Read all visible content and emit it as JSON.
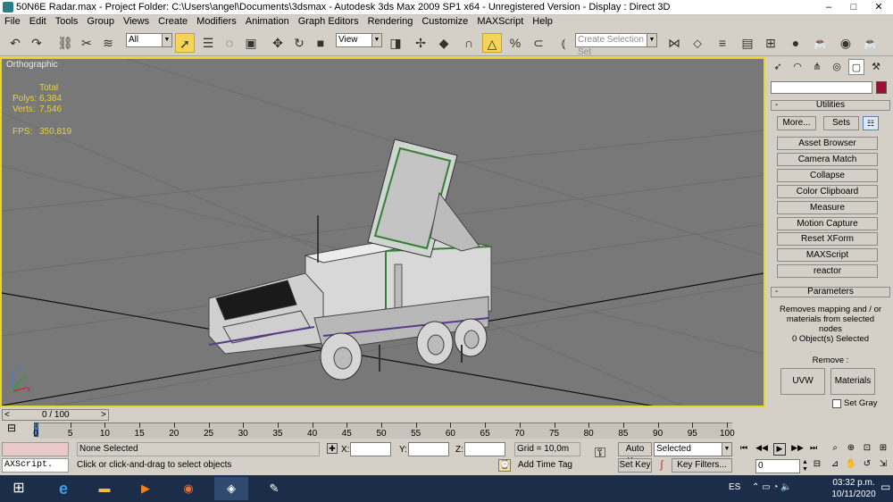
{
  "title": {
    "text": "50N6E Radar.max    - Project Folder: C:\\Users\\angel\\Documents\\3dsmax     - Autodesk 3ds Max  2009 SP1  x64   - Unregistered Version        - Display : Direct 3D"
  },
  "window_controls": {
    "minimize": "–",
    "maximize": "□",
    "close": "✕"
  },
  "menubar": [
    "File",
    "Edit",
    "Tools",
    "Group",
    "Views",
    "Create",
    "Modifiers",
    "Animation",
    "Graph Editors",
    "Rendering",
    "Customize",
    "MAXScript",
    "Help"
  ],
  "toolbar": {
    "selection_filter": "All",
    "reference_coord": "View",
    "named_selection_placeholder": "Create Selection Set",
    "icons": [
      "undo-icon",
      "redo-icon",
      "select-link-icon",
      "unlink-icon",
      "bind-spacewarp-icon",
      "select-object-icon",
      "select-by-name-icon",
      "region-select-icon",
      "window-crossing-icon",
      "move-icon",
      "rotate-icon",
      "scale-icon",
      "pivot-icon",
      "mirror-icon",
      "align-icon",
      "snap-icon",
      "angle-snap-icon",
      "percent-snap-icon",
      "spinner-snap-icon",
      "edit-named-sets-icon",
      "mirror-tool-icon",
      "align-tool-icon",
      "layers-icon",
      "curve-editor-icon",
      "schematic-icon",
      "material-editor-icon",
      "render-scene-icon",
      "quick-render-icon",
      "render-icon"
    ]
  },
  "viewport": {
    "label": "Orthographic",
    "stats": {
      "total_label": "Total",
      "polys_label": "Polys:",
      "polys_value": "6,384",
      "verts_label": "Verts:",
      "verts_value": "7,546",
      "fps_label": "FPS:",
      "fps_value": "350,819"
    },
    "axis": {
      "x": "x",
      "y": "y",
      "z": "z"
    }
  },
  "command_panel": {
    "tab_icons": [
      "create-tab-icon",
      "modify-tab-icon",
      "hierarchy-tab-icon",
      "motion-tab-icon",
      "display-tab-icon",
      "utilities-tab-icon"
    ],
    "name_field": "",
    "color_swatch": "#9e0f35",
    "utilities_rollout": "Utilities",
    "more_button": "More...",
    "sets_button": "Sets",
    "utility_buttons": [
      "Asset Browser",
      "Camera Match",
      "Collapse",
      "Color Clipboard",
      "Measure",
      "Motion Capture",
      "Reset XForm",
      "MAXScript",
      "reactor"
    ],
    "parameters_rollout": "Parameters",
    "description": "Removes mapping and / or materials from selected nodes",
    "selection_status": "0 Object(s) Selected",
    "remove_label": "Remove :",
    "uvw_button": "UVW",
    "materials_button": "Materials",
    "set_gray_label": "Set Gray",
    "minus": "-"
  },
  "timeline": {
    "slider_value": "0 / 100",
    "prev": "<",
    "next": ">",
    "ticks": [
      "0",
      "5",
      "10",
      "15",
      "20",
      "25",
      "30",
      "35",
      "40",
      "45",
      "50",
      "55",
      "60",
      "65",
      "70",
      "75",
      "80",
      "85",
      "90",
      "95",
      "100"
    ]
  },
  "statusbar": {
    "selection_info": "None Selected",
    "prompt": "Click or click-and-drag to select objects",
    "maxscript_label": "AXScript.",
    "x_label": "X:",
    "y_label": "Y:",
    "z_label": "Z:",
    "x_value": "",
    "y_value": "",
    "z_value": "",
    "grid": "Grid = 10,0m",
    "add_time_tag": "Add Time Tag",
    "auto_key": "Auto Key",
    "set_key": "Set Key",
    "key_mode": "Selected",
    "key_filters": "Key Filters...",
    "frame_value": "0"
  },
  "playback_icons": [
    "go-start-icon",
    "prev-frame-icon",
    "play-icon",
    "next-frame-icon",
    "go-end-icon"
  ],
  "nav_icons": [
    "zoom-icon",
    "zoom-all-icon",
    "zoom-extents-icon",
    "zoom-extents-all-icon",
    "fov-icon",
    "pan-icon",
    "orbit-icon",
    "maximize-viewport-icon"
  ],
  "taskbar": {
    "apps": [
      "start-icon",
      "edge-icon",
      "file-explorer-icon",
      "media-player-icon",
      "firefox-icon",
      "3dsmax-icon",
      "painter-icon"
    ],
    "language": "ES",
    "time": "03:32 p.m.",
    "date": "10/11/2020"
  }
}
